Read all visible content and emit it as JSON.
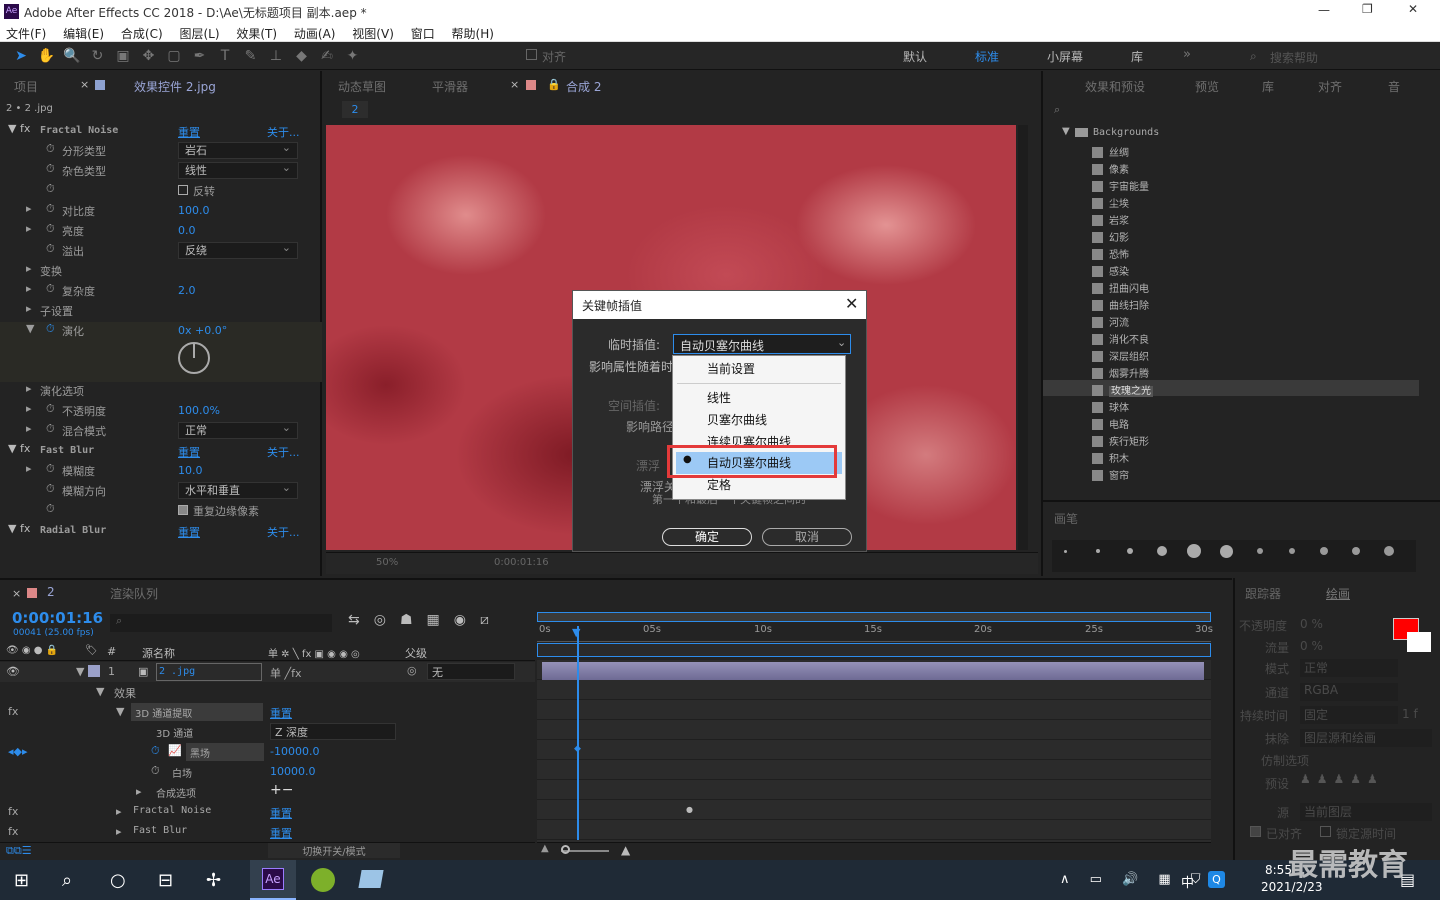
{
  "titlebar": {
    "title": "Adobe After Effects CC 2018 - D:\\Ae\\无标题项目 副本.aep *",
    "minimize": "—",
    "maximize": "❐",
    "close": "✕"
  },
  "menu": [
    "文件(F)",
    "编辑(E)",
    "合成(C)",
    "图层(L)",
    "效果(T)",
    "动画(A)",
    "视图(V)",
    "窗口",
    "帮助(H)"
  ],
  "toolbar": {
    "align_label": "对齐",
    "workspaces": [
      "默认",
      "标准",
      "小屏幕",
      "库"
    ],
    "search_placeholder": "搜索帮助"
  },
  "left_panel": {
    "tabs": [
      "项目",
      "效果控件 2.jpg"
    ],
    "layer_label": "2 • 2 .jpg",
    "rows": [
      {
        "label": "Fractal Noise",
        "reset": "重置",
        "about": "关于..."
      },
      {
        "label": "分形类型",
        "value": "岩石"
      },
      {
        "label": "杂色类型",
        "value": "线性"
      },
      {
        "label": "反转"
      },
      {
        "label": "对比度",
        "value": "100.0"
      },
      {
        "label": "亮度",
        "value": "0.0"
      },
      {
        "label": "溢出",
        "value": "反绕"
      },
      {
        "label": "变换"
      },
      {
        "label": "复杂度",
        "value": "2.0"
      },
      {
        "label": "子设置"
      },
      {
        "label": "演化",
        "value": "0x +0.0°"
      },
      {
        "label": "演化选项"
      },
      {
        "label": "不透明度",
        "value": "100.0%"
      },
      {
        "label": "混合模式",
        "value": "正常"
      },
      {
        "label": "Fast Blur",
        "reset": "重置",
        "about": "关于..."
      },
      {
        "label": "模糊度",
        "value": "10.0"
      },
      {
        "label": "模糊方向",
        "value": "水平和垂直"
      },
      {
        "label": "重复边缘像素"
      },
      {
        "label": "Radial Blur",
        "reset": "重置",
        "about": "关于..."
      }
    ]
  },
  "viewer": {
    "tabs": [
      "动态草图",
      "平滑器",
      "合成 2"
    ],
    "comp_tab": "2",
    "zoom": "50%",
    "timecode": "0:00:01:16"
  },
  "right_panel": {
    "tabs": [
      "效果和预设",
      "预览",
      "库",
      "对齐",
      "音"
    ],
    "folder": "Backgrounds",
    "items": [
      "丝绸",
      "像素",
      "宇宙能量",
      "尘埃",
      "岩浆",
      "幻影",
      "恐怖",
      "感染",
      "扭曲闪电",
      "曲线扫除",
      "河流",
      "消化不良",
      "深层组织",
      "烟雾升腾",
      "玫瑰之光",
      "球体",
      "电路",
      "疾行矩形",
      "积木",
      "窗帘"
    ],
    "selected": "玫瑰之光",
    "brush_tab": "画笔"
  },
  "timeline": {
    "tabs": [
      "2",
      "渲染队列"
    ],
    "timecode": "0:00:01:16",
    "fps": "00041 (25.00 fps)",
    "col_source": "源名称",
    "col_parent": "父级",
    "layer_num": "1",
    "layer_name": "2 .jpg",
    "parent_value": "无",
    "effects_label": "效果",
    "ch_extract": "3D 通道提取",
    "ch_reset": "重置",
    "ch3d": "3D 通道",
    "ch3d_val": "Z 深度",
    "black": "黑场",
    "black_val": "-10000.0",
    "white": "白场",
    "white_val": "10000.0",
    "compopts": "合成选项",
    "fractal": "Fractal Noise",
    "fastblur": "Fast Blur",
    "reset": "重置",
    "switch_label": "切换开关/模式",
    "ruler": [
      "0s",
      "05s",
      "10s",
      "15s",
      "20s",
      "25s",
      "30s"
    ]
  },
  "right_tools": {
    "tabs": [
      "跟踪器",
      "绘画"
    ],
    "rows": [
      "不透明度",
      "流量",
      "模式",
      "通道",
      "持续时间",
      "抹除",
      "仿制选项",
      "预设",
      "源",
      "已对齐",
      "锁定源时间"
    ],
    "opacity": "0 %",
    "flow": "0 %",
    "mode": "正常",
    "channel": "RGBA",
    "duration": "固定",
    "erase": "图层源和绘画",
    "source": "当前图层",
    "frames": "1 f"
  },
  "dialog": {
    "title": "关键帧插值",
    "temporal_label": "临时插值:",
    "temporal_value": "自动贝塞尔曲线",
    "affect_label": "影响属性随着时",
    "spatial_label": "空间插值:",
    "affect2": "影响路径",
    "roving": "漂浮",
    "roving2": "漂浮关",
    "roving3": "第一个和最后一个关键帧之间的",
    "ok": "确定",
    "cancel": "取消",
    "options": [
      "当前设置",
      "线性",
      "贝塞尔曲线",
      "连续贝塞尔曲线",
      "自动贝塞尔曲线",
      "定格"
    ],
    "selected_option": "自动贝塞尔曲线"
  },
  "taskbar": {
    "time": "8:55",
    "date": "2021/2/23",
    "lang": "中",
    "watermark": "最需教育"
  }
}
